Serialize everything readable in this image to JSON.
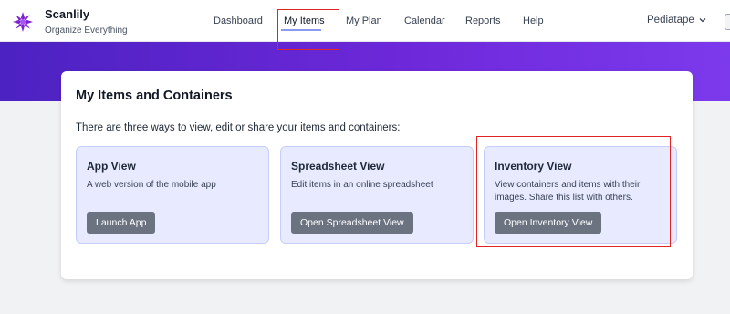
{
  "brand": {
    "name": "Scanlily",
    "tagline": "Organize Everything"
  },
  "nav": {
    "items": [
      {
        "label": "Dashboard"
      },
      {
        "label": "My Items"
      },
      {
        "label": "My Plan"
      },
      {
        "label": "Calendar"
      },
      {
        "label": "Reports"
      },
      {
        "label": "Help"
      }
    ],
    "active": "My Items"
  },
  "user": {
    "name": "Pediatape"
  },
  "colors": {
    "accent": "#7c3aed",
    "button": "#6b7280",
    "panel_bg": "#e8ebff",
    "highlight": "#e02424"
  },
  "main": {
    "title": "My Items and Containers",
    "intro": "There are three ways to view, edit or share your items and containers:",
    "panels": [
      {
        "title": "App View",
        "description": "A web version of the mobile app",
        "button": "Launch App"
      },
      {
        "title": "Spreadsheet View",
        "description": "Edit items in an online spreadsheet",
        "button": "Open Spreadsheet View"
      },
      {
        "title": "Inventory View",
        "description": "View containers and items with their images. Share this list with others.",
        "button": "Open Inventory View"
      }
    ]
  }
}
